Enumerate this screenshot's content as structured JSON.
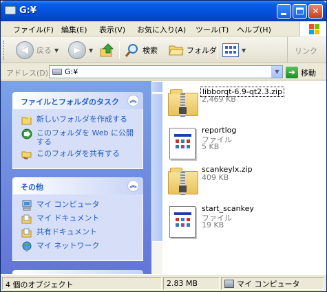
{
  "window": {
    "title": "G:¥"
  },
  "menu": [
    "ファイル(F)",
    "編集(E)",
    "表示(V)",
    "お気に入り(A)",
    "ツール(T)",
    "ヘルプ(H)"
  ],
  "toolbar": {
    "back_label": "戻る",
    "search_label": "検索",
    "folders_label": "フォルダ",
    "links_label": "リンク"
  },
  "address": {
    "label": "アドレス(D)",
    "value": "G:¥",
    "go_label": "移動"
  },
  "left": {
    "tasks_title": "ファイルとフォルダのタスク",
    "tasks": [
      "新しいフォルダを作成する",
      "このフォルダを Web に公開する",
      "このフォルダを共有する"
    ],
    "other_title": "その他",
    "other": [
      "マイ コンピュータ",
      "マイ ドキュメント",
      "共有ドキュメント",
      "マイ ネットワーク"
    ]
  },
  "files": [
    {
      "name": "libborqt-6.9-qt2.3.zip",
      "type": "",
      "size": "2,469 KB",
      "icon": "zip-folder-icon"
    },
    {
      "name": "reportlog",
      "type": "ファイル",
      "size": "5 KB",
      "icon": "file-icon"
    },
    {
      "name": "scankeylx.zip",
      "type": "",
      "size": "409 KB",
      "icon": "zip-folder-icon"
    },
    {
      "name": "start_scankey",
      "type": "ファイル",
      "size": "19 KB",
      "icon": "file-icon"
    }
  ],
  "status": {
    "objects": "4 個のオブジェクト",
    "size": "2.83 MB",
    "location": "マイ コンピュータ"
  },
  "colors": {
    "title_bar": "#0553dd",
    "task_pane": "#6375d6",
    "task_link": "#215dc6"
  }
}
